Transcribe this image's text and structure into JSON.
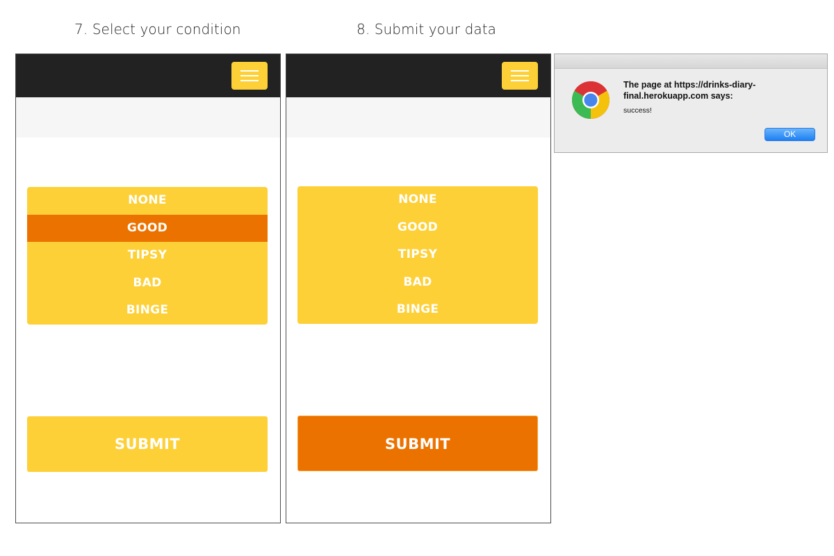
{
  "captions": {
    "step7": "7. Select your condition",
    "step8": "8. Submit your data"
  },
  "screen1": {
    "menu_icon": "hamburger-menu-icon",
    "conditions": [
      "NONE",
      "GOOD",
      "TIPSY",
      "BAD",
      "BINGE"
    ],
    "selected_condition": "GOOD",
    "submit_label": "SUBMIT"
  },
  "screen2": {
    "menu_icon": "hamburger-menu-icon",
    "conditions": [
      "NONE",
      "GOOD",
      "TIPSY",
      "BAD",
      "BINGE"
    ],
    "submit_label": "SUBMIT",
    "submit_state": "pressed"
  },
  "alert": {
    "icon": "chrome-logo-icon",
    "title": "The page at https://drinks-diary-final.herokuapp.com says:",
    "message": "success!",
    "ok_label": "OK"
  },
  "colors": {
    "topbar": "#222222",
    "accent_yellow": "#fdd037",
    "accent_orange": "#ec7200",
    "subbar": "#f6f6f6"
  }
}
